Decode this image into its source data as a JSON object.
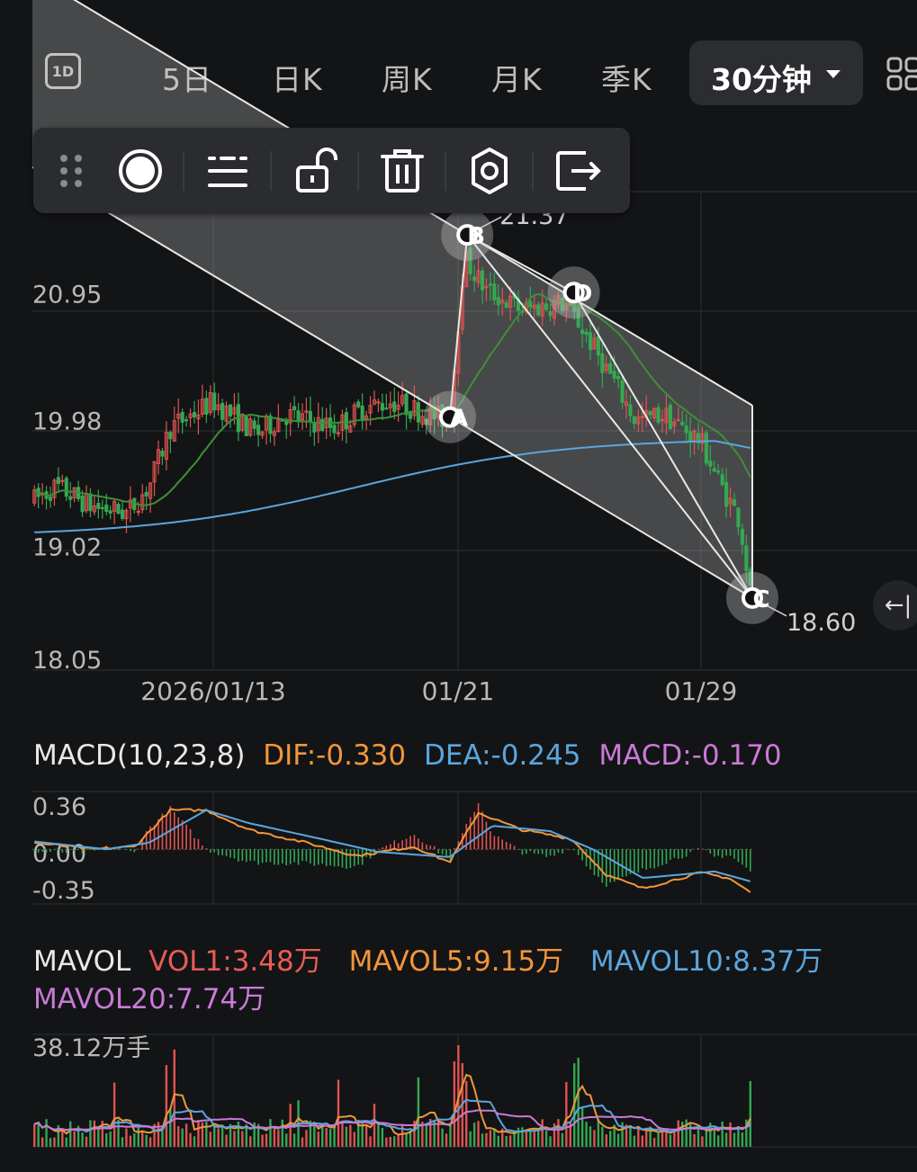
{
  "tabs": {
    "intraday_icon": "1D",
    "items": [
      "5日",
      "日K",
      "周K",
      "月K",
      "季K"
    ],
    "selected": "30分钟"
  },
  "icons": {
    "drag": "drag-handle-icon",
    "circle": "record-icon",
    "line_style": "line-style-icon",
    "unlock": "unlock-icon",
    "delete": "trash-icon",
    "settings": "gear-icon",
    "exit": "exit-icon",
    "layout": "grid-layout-icon",
    "collapse": "collapse-arrow-icon"
  },
  "side_button": "←|",
  "colors": {
    "up": "#e0534f",
    "down": "#34a853",
    "ma_green": "#3f8f39",
    "ma_blue": "#5aa6de",
    "dif": "#f0963a",
    "dea": "#5aa6de",
    "macd": "#c97ad6",
    "vol1": "#e85c55",
    "mavol5": "#f0963a",
    "mavol10": "#5aa6de",
    "mavol20": "#c97ad6"
  },
  "chart_data": [
    {
      "type": "candlestick",
      "y_tick_labels": [
        "20.95",
        "19.98",
        "19.02",
        "18.05"
      ],
      "y_ticks": [
        20.95,
        19.98,
        19.02,
        18.05
      ],
      "ylim": [
        18.05,
        21.7
      ],
      "x_tick_labels": [
        "2026/01/13",
        "01/21",
        "01/29"
      ],
      "drawing": {
        "points": [
          {
            "label": "A",
            "t": 0.58,
            "price": 19.98
          },
          {
            "label": "B",
            "t": 0.604,
            "price": 21.37
          },
          {
            "label": "D",
            "t": 0.752,
            "price": 20.93
          },
          {
            "label": "C",
            "t": 1.0,
            "price": 18.6
          }
        ],
        "annotations": [
          "21.37",
          "18.60"
        ]
      }
    },
    {
      "type": "line",
      "name": "MACD(10,23,8)",
      "y_tick_labels": [
        "0.36",
        "0.00",
        "-0.35"
      ],
      "ylim": [
        -0.35,
        0.36
      ],
      "legend": {
        "title": "MACD(10,23,8)",
        "dif": "DIF:-0.330",
        "dea": "DEA:-0.245",
        "macd": "MACD:-0.170"
      }
    },
    {
      "type": "bar",
      "name": "MAVOL",
      "y_tick_labels": [
        "38.12万手"
      ],
      "legend": {
        "title": "MAVOL",
        "vol1": "VOL1:3.48万",
        "mavol5": "MAVOL5:9.15万",
        "mavol10": "MAVOL10:8.37万",
        "mavol20": "MAVOL20:7.74万"
      }
    }
  ]
}
